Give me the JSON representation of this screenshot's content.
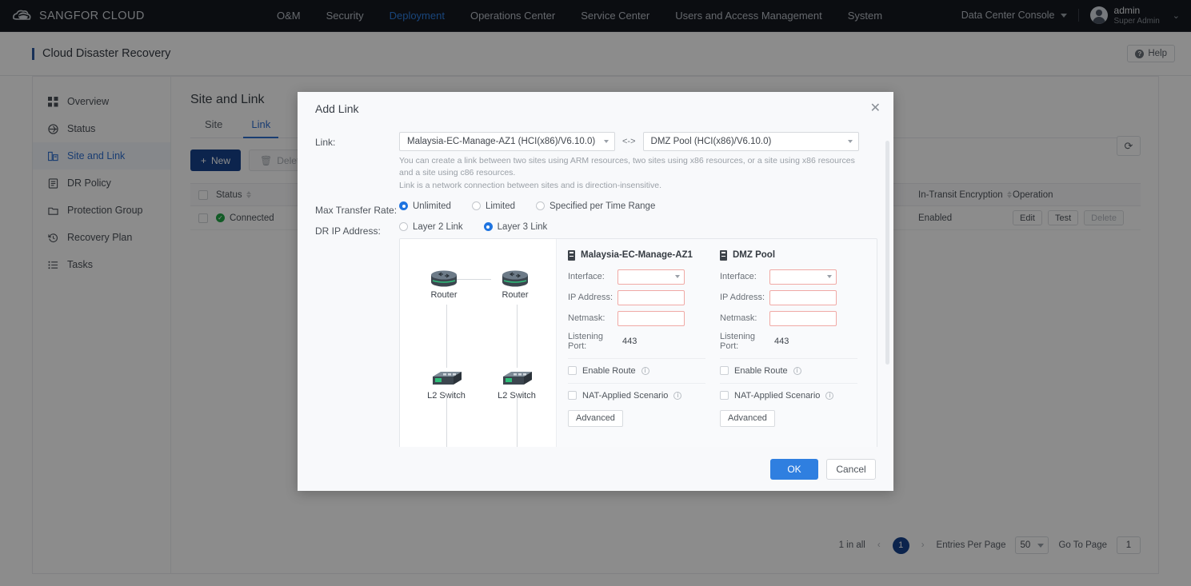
{
  "topnav": {
    "brand": "SANGFOR CLOUD",
    "items": [
      {
        "label": "O&M",
        "active": false
      },
      {
        "label": "Security",
        "active": false
      },
      {
        "label": "Deployment",
        "active": true
      },
      {
        "label": "Operations Center",
        "active": false
      },
      {
        "label": "Service Center",
        "active": false
      },
      {
        "label": "Users and Access Management",
        "active": false
      },
      {
        "label": "System",
        "active": false
      }
    ],
    "console_selector": "Data Center Console",
    "user_name": "admin",
    "user_role": "Super Admin",
    "accent": "#2f7fe0"
  },
  "page_header": {
    "title": "Cloud Disaster Recovery",
    "help_label": "Help"
  },
  "sidebar": {
    "items": [
      {
        "label": "Overview",
        "icon": "grid-icon",
        "active": false
      },
      {
        "label": "Status",
        "icon": "status-icon",
        "active": false
      },
      {
        "label": "Site and Link",
        "icon": "site-link-icon",
        "active": true
      },
      {
        "label": "DR Policy",
        "icon": "document-icon",
        "active": false
      },
      {
        "label": "Protection Group",
        "icon": "folder-icon",
        "active": false
      },
      {
        "label": "Recovery Plan",
        "icon": "history-icon",
        "active": false
      },
      {
        "label": "Tasks",
        "icon": "list-icon",
        "active": false
      }
    ]
  },
  "main": {
    "title": "Site and Link",
    "tabs": [
      {
        "label": "Site",
        "active": false
      },
      {
        "label": "Link",
        "active": true
      }
    ],
    "toolbar": {
      "new_label": "New",
      "delete_label": "Delete",
      "refresh_icon": "refresh-icon"
    },
    "table": {
      "columns": [
        "Status",
        "In-Transit Encryption",
        "Operation"
      ],
      "rows": [
        {
          "status": "Connected",
          "encryption": "Enabled",
          "operations": [
            {
              "label": "Edit",
              "disabled": false
            },
            {
              "label": "Test",
              "disabled": false
            },
            {
              "label": "Delete",
              "disabled": true
            }
          ]
        }
      ]
    },
    "pagination": {
      "total_text": "1 in all",
      "current_page": "1",
      "entries_label": "Entries Per Page",
      "entries_value": "50",
      "goto_label": "Go To Page",
      "goto_value": "1"
    }
  },
  "modal": {
    "title": "Add Link",
    "close_icon": "close-icon",
    "link": {
      "label": "Link:",
      "source": "Malaysia-EC-Manage-AZ1 (HCI(x86)/V6.10.0)",
      "connector": "<->",
      "target": "DMZ Pool (HCI(x86)/V6.10.0)",
      "hint_line1": "You can create a link between two sites using ARM resources, two sites using x86 resources, or a site using x86 resources and a site using c86 resources.",
      "hint_line2": "Link is a network connection between sites and is direction-insensitive."
    },
    "max_transfer_rate": {
      "label": "Max Transfer Rate:",
      "options": [
        {
          "label": "Unlimited",
          "selected": true
        },
        {
          "label": "Limited",
          "selected": false
        },
        {
          "label": "Specified per Time Range",
          "selected": false
        }
      ]
    },
    "dr_ip_address": {
      "label": "DR IP Address:",
      "options": [
        {
          "label": "Layer 2 Link",
          "selected": false
        },
        {
          "label": "Layer 3 Link",
          "selected": true
        }
      ]
    },
    "diagram": {
      "nodes": [
        {
          "label": "Router"
        },
        {
          "label": "Router"
        },
        {
          "label": "L2 Switch"
        },
        {
          "label": "L2 Switch"
        }
      ]
    },
    "columns": [
      {
        "site_name": "Malaysia-EC-Manage-AZ1",
        "interface_label": "Interface:",
        "interface_value": "",
        "ip_label": "IP Address:",
        "ip_value": "",
        "netmask_label": "Netmask:",
        "netmask_value": "",
        "port_label": "Listening Port:",
        "port_value": "443",
        "enable_route_label": "Enable Route",
        "enable_route_checked": false,
        "nat_label": "NAT-Applied Scenario",
        "nat_checked": false,
        "advanced_label": "Advanced"
      },
      {
        "site_name": "DMZ Pool",
        "interface_label": "Interface:",
        "interface_value": "",
        "ip_label": "IP Address:",
        "ip_value": "",
        "netmask_label": "Netmask:",
        "netmask_value": "",
        "port_label": "Listening Port:",
        "port_value": "443",
        "enable_route_label": "Enable Route",
        "enable_route_checked": false,
        "nat_label": "NAT-Applied Scenario",
        "nat_checked": false,
        "advanced_label": "Advanced"
      }
    ],
    "footer": {
      "ok_label": "OK",
      "cancel_label": "Cancel"
    }
  }
}
